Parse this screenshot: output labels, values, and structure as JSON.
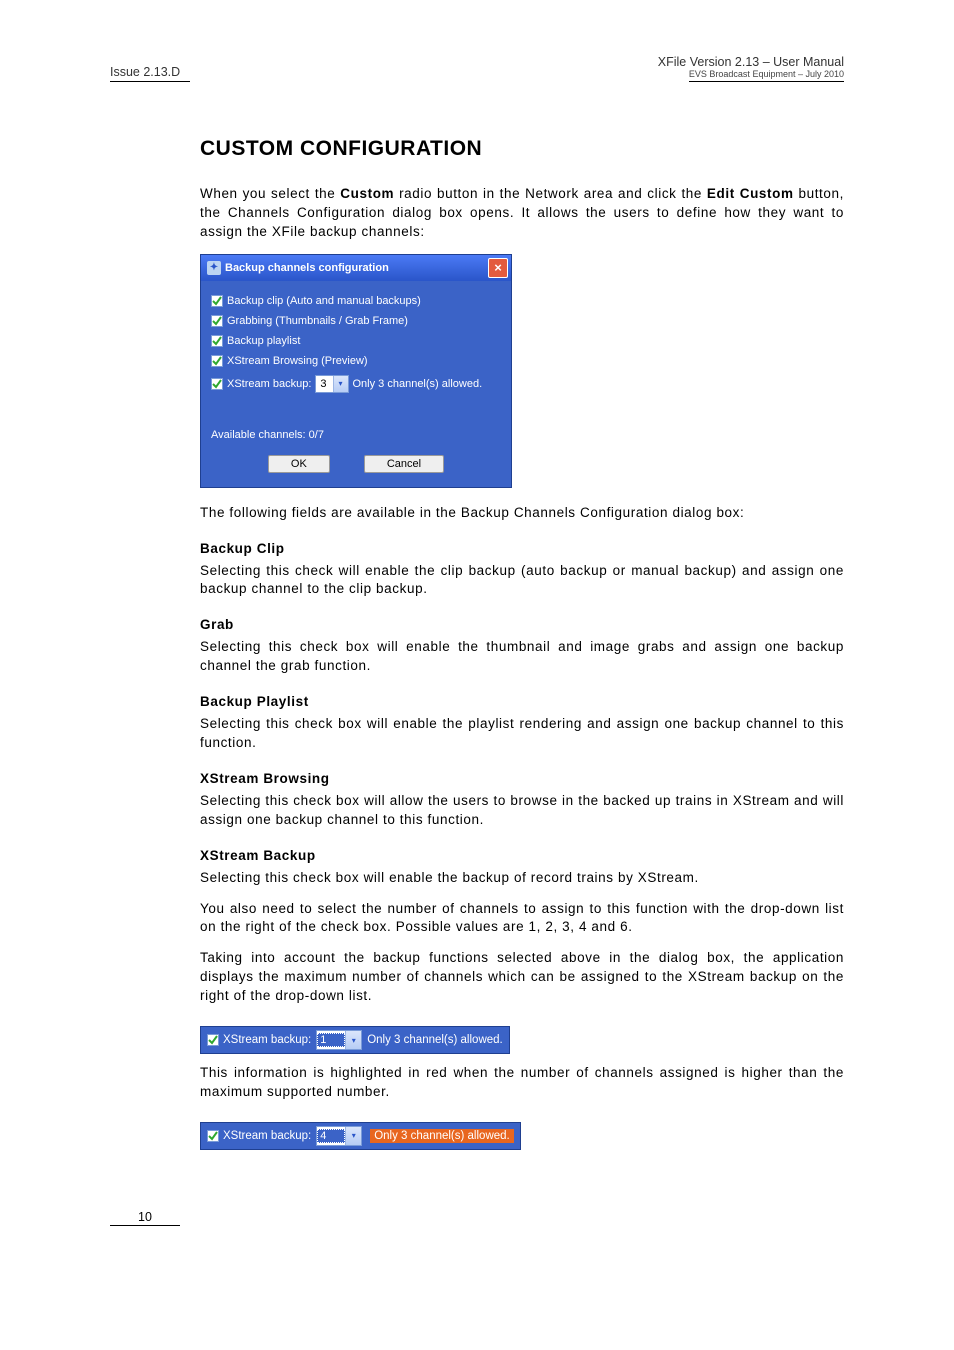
{
  "header": {
    "issue": "Issue 2.13.D",
    "title": "XFile Version 2.13 – User Manual",
    "subtitle": "EVS Broadcast Equipment – July 2010"
  },
  "page_number": "10",
  "section_title": "CUSTOM CONFIGURATION",
  "intro_before_custom": "When you select the ",
  "intro_custom": "Custom",
  "intro_mid": " radio button in the Network area and click the ",
  "intro_edit": "Edit Custom",
  "intro_after": " button, the Channels Configuration dialog box opens. It allows the users to define how they want to assign the XFile backup channels:",
  "dialog": {
    "title": "Backup channels configuration",
    "opt_backup_clip": "Backup clip (Auto and manual backups)",
    "opt_grabbing": "Grabbing (Thumbnails / Grab Frame)",
    "opt_backup_playlist": "Backup playlist",
    "opt_xstream_browsing": "XStream Browsing (Preview)",
    "opt_xstream_backup_label": "XStream backup:",
    "xstream_backup_value": "3",
    "xstream_backup_note": "Only 3 channel(s) allowed.",
    "available": "Available channels: 0/7",
    "ok": "OK",
    "cancel": "Cancel"
  },
  "para_following": "The following fields are available in the Backup Channels Configuration dialog box:",
  "fields": {
    "backup_clip": {
      "title": "Backup Clip",
      "text": "Selecting this check will enable the clip backup (auto backup or manual backup) and assign one backup channel to the clip backup."
    },
    "grab": {
      "title": "Grab",
      "text": "Selecting this check box will enable the thumbnail and image grabs and assign one backup channel the grab function."
    },
    "backup_playlist": {
      "title": "Backup Playlist",
      "text": "Selecting this check box will enable the playlist rendering and assign one backup channel to this function."
    },
    "xstream_browsing": {
      "title": "XStream Browsing",
      "text": "Selecting this check box will allow the users to browse in the backed up trains in XStream and will assign one backup channel to this function."
    },
    "xstream_backup": {
      "title": "XStream Backup",
      "p1": "Selecting this check box will enable the backup of record trains by XStream.",
      "p2": "You also need to select the number of channels to assign to this function with the drop-down list on the right of the check box. Possible values are 1, 2, 3, 4 and 6.",
      "p3": "Taking into account the backup functions selected above in the dialog box, the application displays the maximum number of channels which can be assigned to the XStream backup on the right of the drop-down list.",
      "p4": "This information is highlighted in red when the number of channels assigned is higher than the maximum supported number."
    }
  },
  "strip1": {
    "label": "XStream backup:",
    "value": "1",
    "note": "Only 3 channel(s) allowed."
  },
  "strip2": {
    "label": "XStream backup:",
    "value": "4",
    "note": "Only 3 channel(s) allowed."
  }
}
